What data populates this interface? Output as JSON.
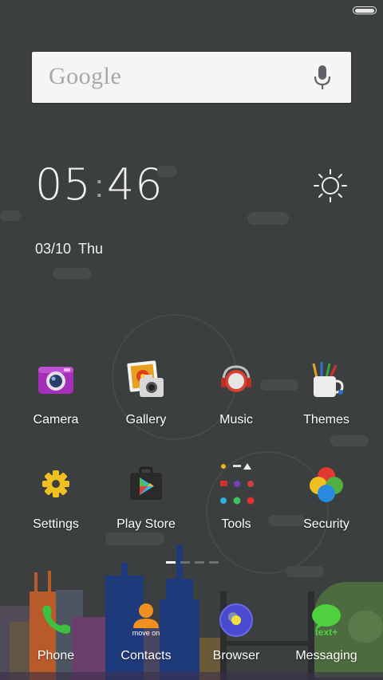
{
  "search": {
    "logo_text": "Google"
  },
  "clock": {
    "hours": "05",
    "separator": ":",
    "minutes": "46"
  },
  "date": {
    "day_month": "03/10",
    "weekday": "Thu"
  },
  "apps": [
    {
      "label": "Camera",
      "icon": "camera-icon"
    },
    {
      "label": "Gallery",
      "icon": "gallery-icon"
    },
    {
      "label": "Music",
      "icon": "music-icon"
    },
    {
      "label": "Themes",
      "icon": "themes-icon"
    },
    {
      "label": "Settings",
      "icon": "settings-icon"
    },
    {
      "label": "Play Store",
      "icon": "play-store-icon"
    },
    {
      "label": "Tools",
      "icon": "tools-folder-icon"
    },
    {
      "label": "Security",
      "icon": "security-icon"
    }
  ],
  "dock": [
    {
      "label": "Phone",
      "icon": "phone-icon"
    },
    {
      "label": "Contacts",
      "icon": "contacts-icon",
      "badge_text": "move on"
    },
    {
      "label": "Browser",
      "icon": "browser-icon"
    },
    {
      "label": "Messaging",
      "icon": "messaging-icon",
      "badge_text": "text+"
    }
  ],
  "pager": {
    "page_count": 4,
    "current_page": 1
  },
  "colors": {
    "background": "#3b3f40",
    "search_bg": "#f5f5f5",
    "text": "#ffffff"
  }
}
